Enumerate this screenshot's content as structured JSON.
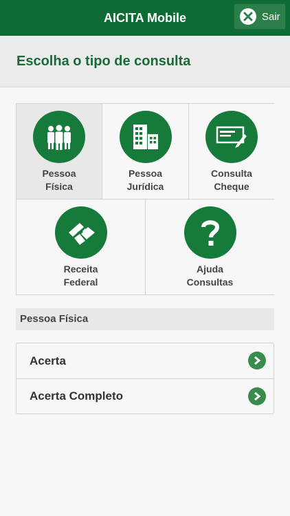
{
  "header": {
    "title": "AICITA Mobile",
    "exit_label": "Sair",
    "exit_icon": "close-circle-icon"
  },
  "page": {
    "title": "Escolha o tipo de consulta"
  },
  "tiles": [
    {
      "line1": "Pessoa",
      "line2": "Física",
      "icon": "people-icon",
      "selected": true
    },
    {
      "line1": "Pessoa",
      "line2": "Jurídica",
      "icon": "buildings-icon",
      "selected": false
    },
    {
      "line1": "Consulta",
      "line2": "Cheque",
      "icon": "cheque-icon",
      "selected": false
    },
    {
      "line1": "Receita",
      "line2": "Federal",
      "icon": "receita-federal-icon",
      "selected": false
    },
    {
      "line1": "Ajuda",
      "line2": "Consultas",
      "icon": "question-icon",
      "selected": false
    }
  ],
  "section": {
    "title": "Pessoa Física"
  },
  "list": {
    "items": [
      {
        "label": "Acerta",
        "icon": "chevron-right-icon"
      },
      {
        "label": "Acerta Completo",
        "icon": "chevron-right-icon"
      }
    ]
  },
  "colors": {
    "primary": "#0f6b34",
    "icon_bg": "#157a3a",
    "chevron": "#3a8b4e",
    "title_text": "#1a6a37"
  }
}
